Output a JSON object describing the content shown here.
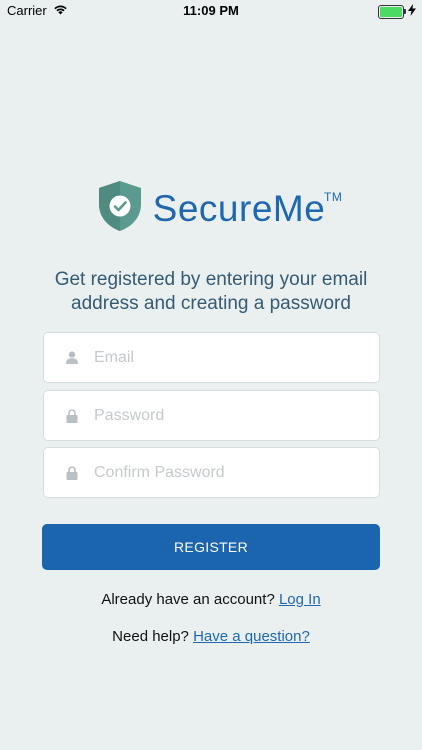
{
  "status_bar": {
    "carrier": "Carrier",
    "time": "11:09 PM"
  },
  "logo": {
    "name": "SecureMe",
    "tm": "TM",
    "color": "#1f68b0",
    "shield_color": "#5b9a8f"
  },
  "tagline": "Get registered by entering your email address and creating a password",
  "form": {
    "email_placeholder": "Email",
    "password_placeholder": "Password",
    "confirm_placeholder": "Confirm Password"
  },
  "register_button": "REGISTER",
  "login_prompt": {
    "text": "Already have an account?",
    "link": "Log In"
  },
  "help_prompt": {
    "text": "Need help?",
    "link": "Have a question?"
  },
  "colors": {
    "background": "#eaf0f0",
    "button": "#1b64ae",
    "link": "#1f68b0",
    "battery": "#4cd964"
  }
}
